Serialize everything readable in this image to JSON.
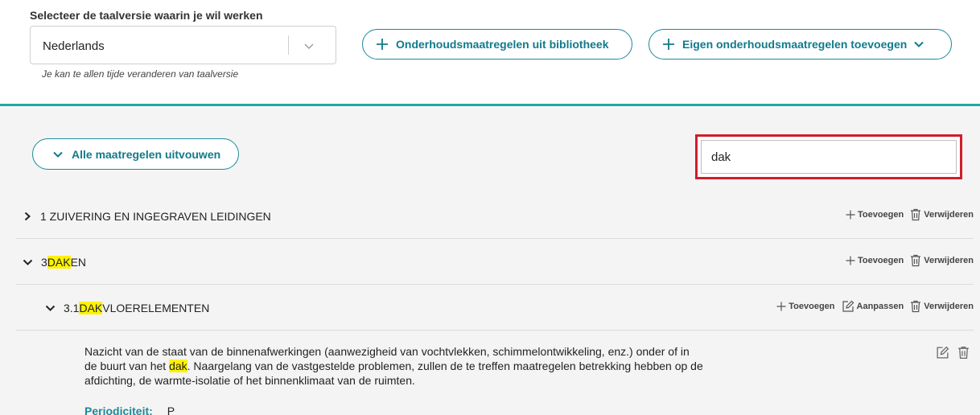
{
  "language": {
    "label": "Selecteer de taalversie waarin je wil werken",
    "value": "Nederlands",
    "hint": "Je kan te allen tijde veranderen van taalversie"
  },
  "buttons": {
    "library": "Onderhoudsmaatregelen uit bibliotheek",
    "own": "Eigen onderhoudsmaatregelen toevoegen",
    "expand_all": "Alle maatregelen uitvouwen"
  },
  "search": {
    "value": "dak"
  },
  "actions": {
    "add": "Toevoegen",
    "edit": "Aanpassen",
    "delete": "Verwijderen"
  },
  "sections": [
    {
      "title_pre": "1 ZUIVERING EN INGEGRAVEN LEIDINGEN",
      "title_hl": "",
      "title_post": "",
      "expanded": false
    },
    {
      "title_pre": "3 ",
      "title_hl": "DAK",
      "title_post": "EN",
      "expanded": true
    },
    {
      "title_pre": "3.1 ",
      "title_hl": "DAK",
      "title_post": "VLOERELEMENTEN",
      "expanded": true
    }
  ],
  "measure": {
    "text_pre": "Nazicht van de staat van de binnenafwerkingen (aanwezigheid van vochtvlekken, schimmelontwikkeling, enz.) onder of in de buurt van het ",
    "text_hl": "dak",
    "text_post": ". Naargelang van de vastgestelde problemen, zullen de te treffen maatregelen betrekking hebben op de afdichting, de warmte-isolatie of het binnenklimaat van de ruimten.",
    "period_label": "Periodiciteit:",
    "period_value": "P"
  },
  "colors": {
    "accent": "#117a8b",
    "divider": "#1ea9a9",
    "search_highlight": "#d21c2a",
    "match": "#fff200"
  }
}
